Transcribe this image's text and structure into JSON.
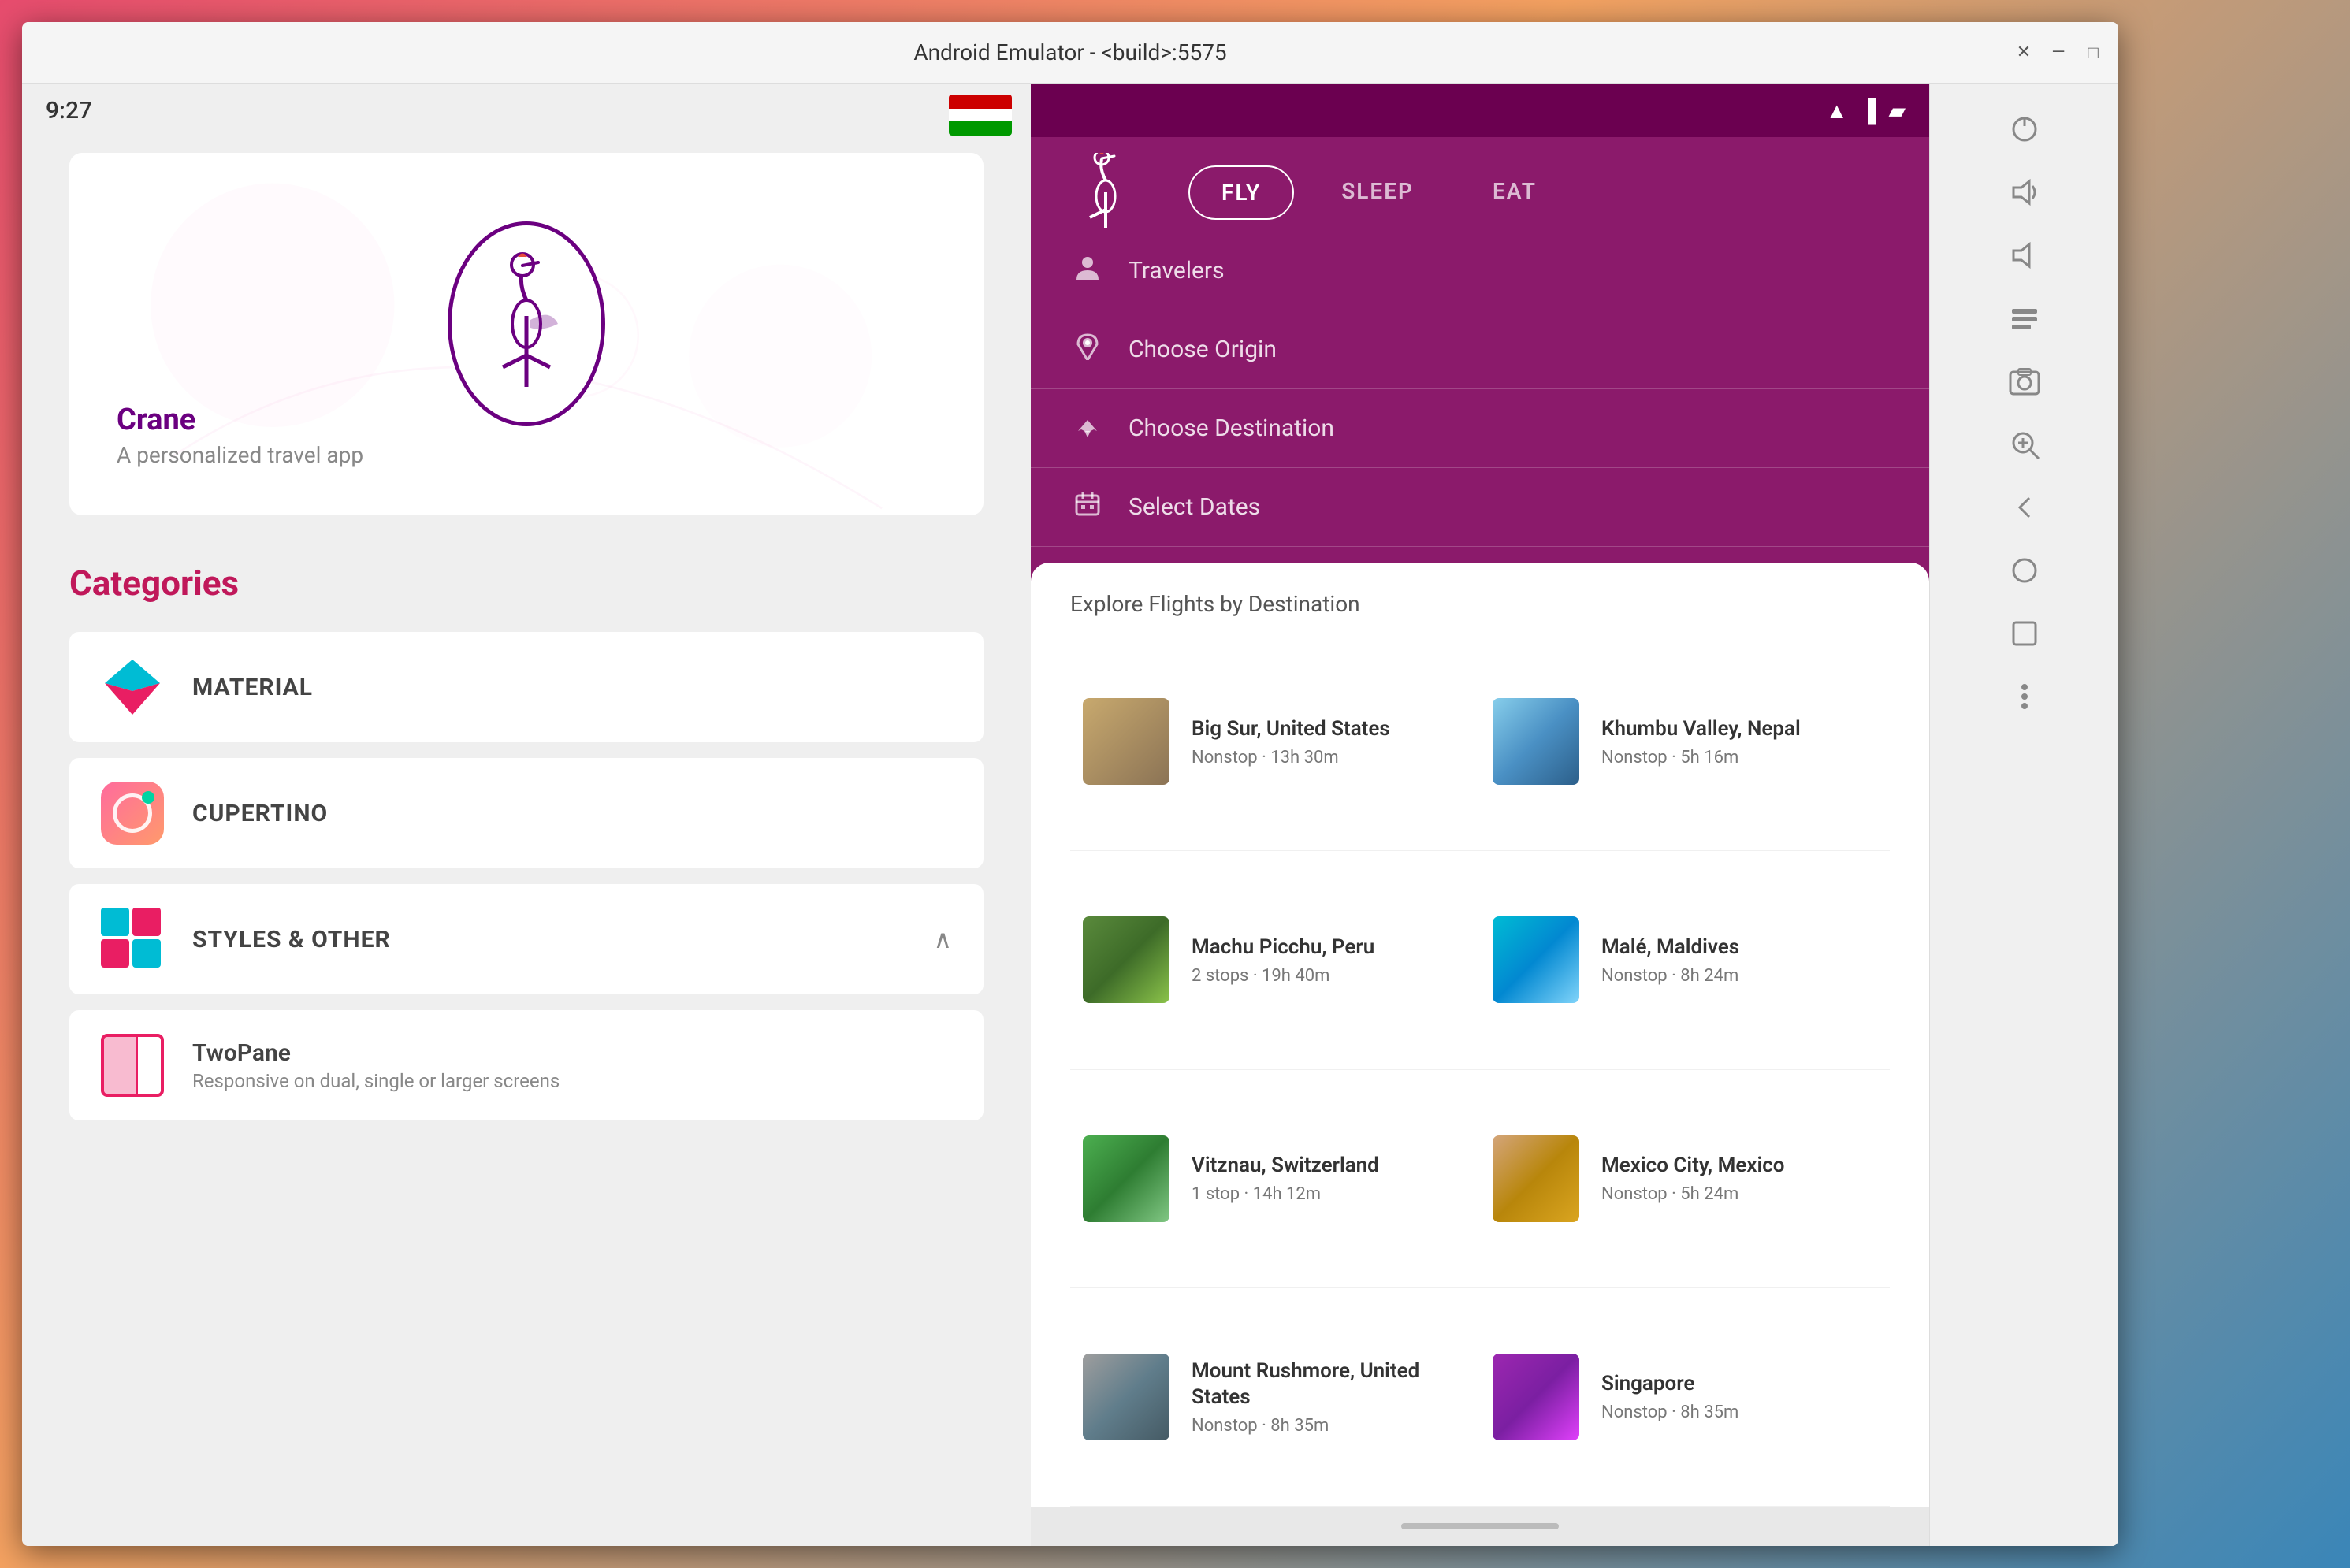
{
  "window": {
    "title": "Android Emulator - <build>:5575",
    "controls": {
      "close": "✕",
      "minimize": "—",
      "maximize": "□"
    }
  },
  "left_panel": {
    "status_time": "9:27",
    "gallery": {
      "app_name": "Crane",
      "app_subtitle": "A personalized travel app"
    },
    "categories": {
      "title": "Categories",
      "items": [
        {
          "id": "material",
          "label": "MATERIAL"
        },
        {
          "id": "cupertino",
          "label": "CUPERTINO"
        },
        {
          "id": "styles",
          "label": "STYLES & OTHER",
          "expanded": true,
          "subitems": [
            {
              "id": "twopane",
              "title": "TwoPane",
              "subtitle": "Responsive on dual, single or larger screens"
            }
          ]
        }
      ]
    }
  },
  "right_panel": {
    "nav_tabs": [
      {
        "id": "fly",
        "label": "FLY",
        "active": true
      },
      {
        "id": "sleep",
        "label": "SLEEP",
        "active": false
      },
      {
        "id": "eat",
        "label": "EAT",
        "active": false
      }
    ],
    "search_form": {
      "travelers": {
        "label": "Travelers",
        "icon": "person"
      },
      "origin": {
        "label": "Choose Origin",
        "icon": "location_pin"
      },
      "destination": {
        "label": "Choose Destination",
        "icon": "airplane"
      },
      "dates": {
        "label": "Select Dates",
        "icon": "calendar"
      }
    },
    "explore_section": {
      "title": "Explore Flights by Destination",
      "destinations": [
        {
          "id": "bigsur",
          "name": "Big Sur, United States",
          "route": "Nonstop · 13h 30m",
          "thumb_class": "thumb-bigsur"
        },
        {
          "id": "khumbu",
          "name": "Khumbu Valley, Nepal",
          "route": "Nonstop · 5h 16m",
          "thumb_class": "thumb-khumbu"
        },
        {
          "id": "machu",
          "name": "Machu Picchu, Peru",
          "route": "2 stops · 19h 40m",
          "thumb_class": "thumb-machu"
        },
        {
          "id": "male",
          "name": "Malé, Maldives",
          "route": "Nonstop · 8h 24m",
          "thumb_class": "thumb-male"
        },
        {
          "id": "vitznau",
          "name": "Vitznau, Switzerland",
          "route": "1 stop · 14h 12m",
          "thumb_class": "thumb-vitznau"
        },
        {
          "id": "mexico",
          "name": "Mexico City, Mexico",
          "route": "Nonstop · 5h 24m",
          "thumb_class": "thumb-mexico"
        },
        {
          "id": "rushmore",
          "name": "Mount Rushmore, United States",
          "route": "Nonstop · 8h 35m",
          "thumb_class": "thumb-rushmore"
        },
        {
          "id": "singapore",
          "name": "Singapore",
          "route": "Nonstop · 8h 35m",
          "thumb_class": "thumb-singapore"
        }
      ]
    }
  }
}
